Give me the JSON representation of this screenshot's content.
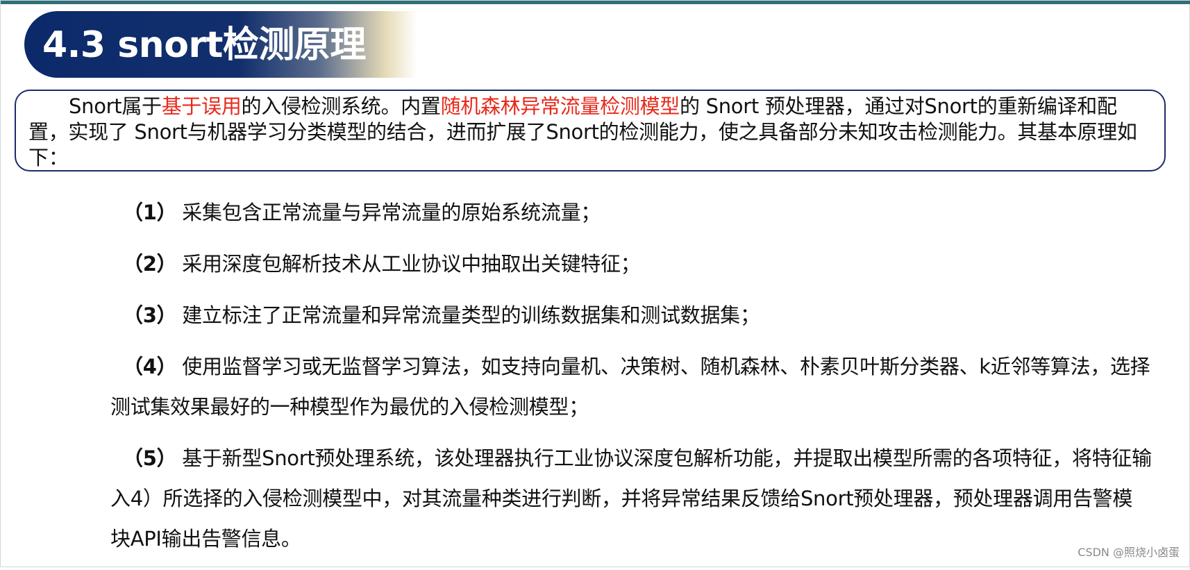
{
  "title": "4.3 snort检测原理",
  "intro": {
    "p1": "Snort属于",
    "h1": "基于误用",
    "p2": "的入侵检测系统。内置",
    "h2": "随机森林异常流量检测模型",
    "p3": "的 Snort 预处理器，通过对Snort的重新编译和配置，实现了 Snort与机器学习分类模型的结合，进而扩展了Snort的检测能力，使之具备部分未知攻击检测能力。其基本原理如下："
  },
  "steps": [
    {
      "num": "（1）",
      "text": "采集包含正常流量与异常流量的原始系统流量；"
    },
    {
      "num": "（2）",
      "text": "采用深度包解析技术从工业协议中抽取出关键特征；"
    },
    {
      "num": "（3）",
      "text": "建立标注了正常流量和异常流量类型的训练数据集和测试数据集；"
    },
    {
      "num": "（4）",
      "text": "使用监督学习或无监督学习算法，如支持向量机、决策树、随机森林、朴素贝叶斯分类器、k近邻等算法，选择测试集效果最好的一种模型作为最优的入侵检测模型；"
    },
    {
      "num": "（5）",
      "text": "基于新型Snort预处理系统，该处理器执行工业协议深度包解析功能，并提取出模型所需的各项特征，将特征输入4）所选择的入侵检测模型中，对其流量种类进行判断，并将异常结果反馈给Snort预处理器，预处理器调用告警模块API输出告警信息。"
    }
  ],
  "watermark": "CSDN @照烧小卤蛋",
  "colors": {
    "banner": "#122f6d",
    "highlight": "#e8291c",
    "border": "#1c2b6a",
    "top_rule": "#2f6f78"
  }
}
